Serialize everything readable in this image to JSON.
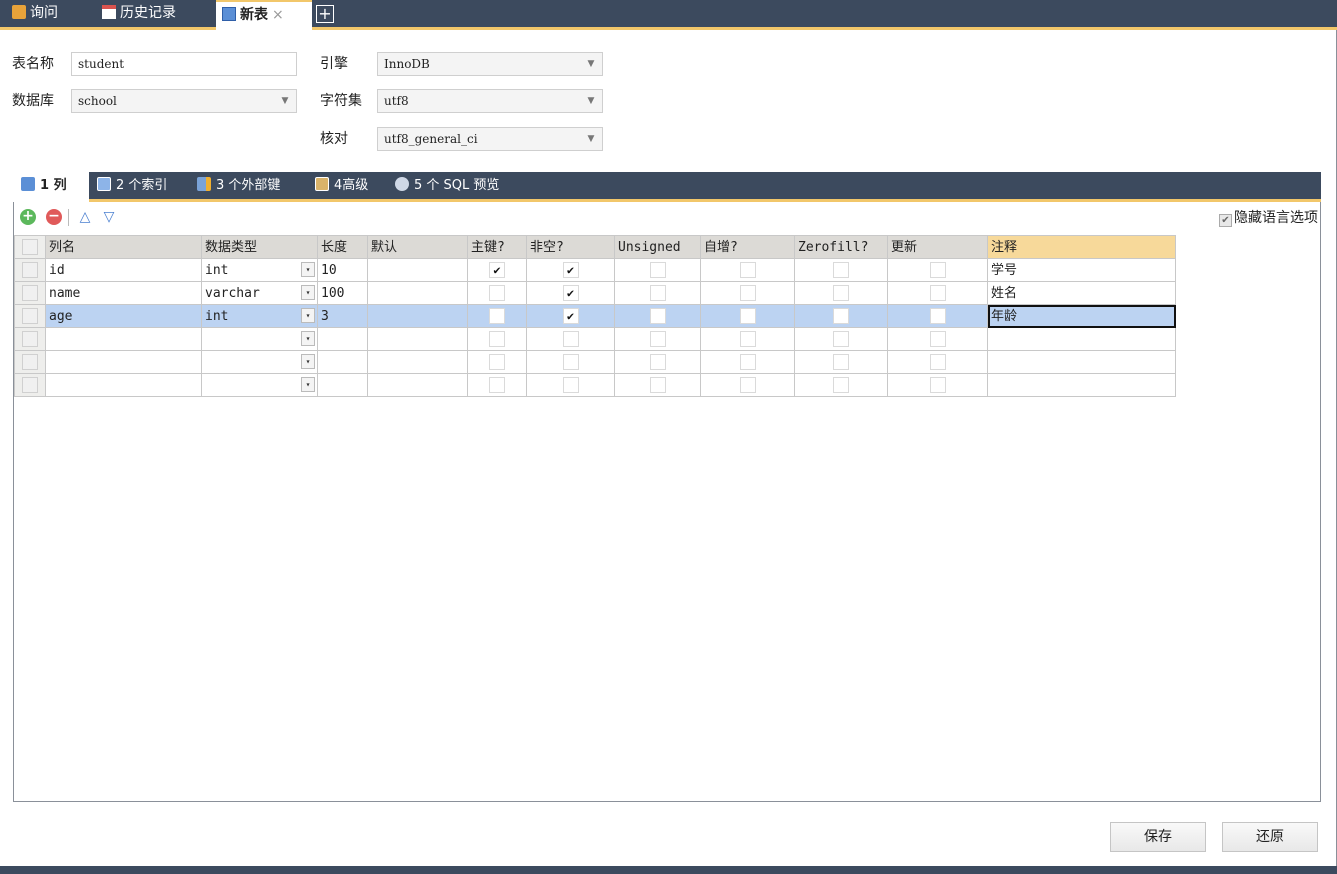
{
  "tabs": {
    "query": "询问",
    "history": "历史记录",
    "new_table": "新表",
    "close": "×",
    "add": "+"
  },
  "form": {
    "table_name_label": "表名称",
    "table_name_value": "student",
    "database_label": "数据库",
    "database_value": "school",
    "engine_label": "引擎",
    "engine_value": "InnoDB",
    "charset_label": "字符集",
    "charset_value": "utf8",
    "collation_label": "核对",
    "collation_value": "utf8_general_ci"
  },
  "subtabs": {
    "columns": "1 列",
    "indexes": "2 个索引",
    "foreign_keys": "3 个外部键",
    "advanced": "4高级",
    "sql_preview": "5 个 SQL 预览"
  },
  "toolbar": {
    "hide_lang_label": "隐藏语言选项",
    "add": "+",
    "del": "−",
    "up": "△",
    "down": "▽"
  },
  "grid": {
    "headers": [
      "列名",
      "数据类型",
      "长度",
      "默认",
      "主键?",
      "非空?",
      "Unsigned",
      "自增?",
      "Zerofill?",
      "更新",
      "注释"
    ],
    "rows": [
      {
        "name": "id",
        "type": "int",
        "length": "10",
        "default": "",
        "pk": true,
        "notnull": true,
        "unsigned": false,
        "autoinc": false,
        "zerofill": false,
        "update": false,
        "comment": "学号"
      },
      {
        "name": "name",
        "type": "varchar",
        "length": "100",
        "default": "",
        "pk": false,
        "notnull": true,
        "unsigned": false,
        "autoinc": false,
        "zerofill": false,
        "update": false,
        "comment": "姓名"
      },
      {
        "name": "age",
        "type": "int",
        "length": "3",
        "default": "",
        "pk": false,
        "notnull": true,
        "unsigned": false,
        "autoinc": false,
        "zerofill": false,
        "update": false,
        "comment": "年龄"
      },
      {
        "name": "",
        "type": "",
        "length": "",
        "default": "",
        "pk": false,
        "notnull": false,
        "unsigned": false,
        "autoinc": false,
        "zerofill": false,
        "update": false,
        "comment": ""
      },
      {
        "name": "",
        "type": "",
        "length": "",
        "default": "",
        "pk": false,
        "notnull": false,
        "unsigned": false,
        "autoinc": false,
        "zerofill": false,
        "update": false,
        "comment": ""
      },
      {
        "name": "",
        "type": "",
        "length": "",
        "default": "",
        "pk": false,
        "notnull": false,
        "unsigned": false,
        "autoinc": false,
        "zerofill": false,
        "update": false,
        "comment": ""
      }
    ],
    "selected_row": 2,
    "check_glyph": "✔",
    "dropdown_glyph": "▾"
  },
  "footer": {
    "save": "保存",
    "revert": "还原"
  },
  "colors": {
    "chrome": "#3c4a5e",
    "accent": "#f2c76a",
    "selection": "#bcd3f2"
  },
  "icons": {
    "query": "query-icon",
    "history": "calendar-icon",
    "new_table": "table-icon",
    "columns": "columns-icon",
    "indexes": "index-icon",
    "foreign_keys": "foreign-key-icon",
    "advanced": "advanced-icon",
    "sql_preview": "sql-icon"
  }
}
